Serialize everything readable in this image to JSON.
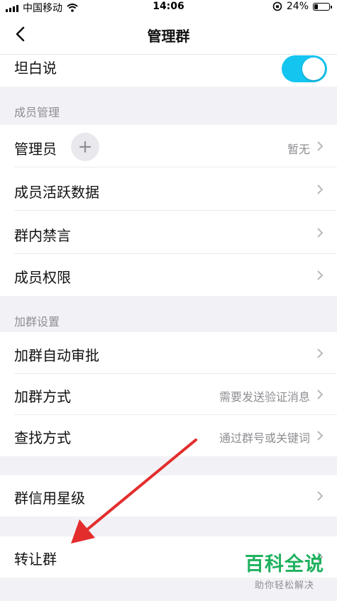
{
  "status_bar": {
    "carrier": "中国移动",
    "time": "14:06",
    "battery": "24%",
    "battery_level": 0.24
  },
  "nav": {
    "title": "管理群"
  },
  "toggle_row": {
    "label": "坦白说",
    "enabled": true
  },
  "member_section": {
    "title": "成员管理",
    "items": [
      {
        "label": "管理员",
        "value": "暂无"
      },
      {
        "label": "成员活跃数据",
        "value": ""
      },
      {
        "label": "群内禁言",
        "value": ""
      },
      {
        "label": "成员权限",
        "value": ""
      }
    ]
  },
  "join_section": {
    "title": "加群设置",
    "items": [
      {
        "label": "加群自动审批",
        "value": ""
      },
      {
        "label": "加群方式",
        "value": "需要发送验证消息"
      },
      {
        "label": "查找方式",
        "value": "通过群号或关键词"
      }
    ]
  },
  "credit_row": {
    "label": "群信用星级"
  },
  "transfer_row": {
    "label": "转让群"
  },
  "watermark": {
    "brand": "百科全说",
    "slogan": "助你轻松解决"
  },
  "colors": {
    "accent": "#14c5f0",
    "arrow": "#e32d2d",
    "brand": "#1fb15e"
  }
}
